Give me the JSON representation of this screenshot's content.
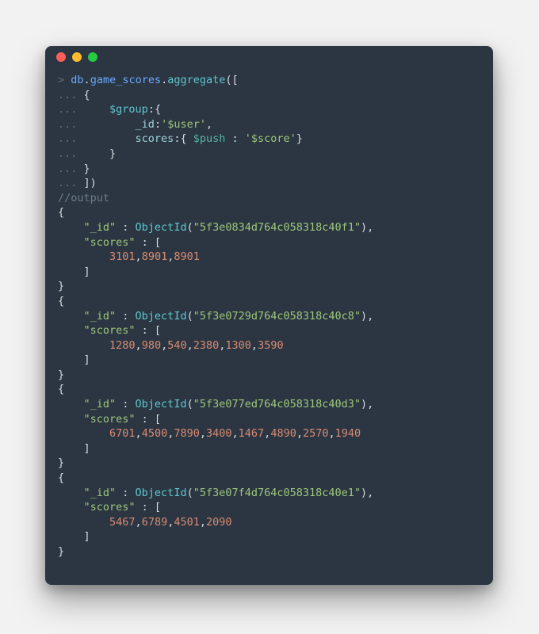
{
  "prompt": ">",
  "cont": "...",
  "cmd": {
    "obj": "db",
    "coll": "game_scores",
    "fn": "aggregate",
    "group_kw": "$group",
    "id_kw": "_id",
    "id_val": "'$user'",
    "scores_kw": "scores",
    "push_kw": "$push",
    "push_val": "'$score'"
  },
  "output_comment": "//output",
  "records": [
    {
      "id": "5f3e0834d764c058318c40f1",
      "scores": [
        3101,
        8901,
        8901
      ]
    },
    {
      "id": "5f3e0729d764c058318c40c8",
      "scores": [
        1280,
        980,
        540,
        2380,
        1300,
        3590
      ]
    },
    {
      "id": "5f3e077ed764c058318c40d3",
      "scores": [
        6701,
        4500,
        7890,
        3400,
        1467,
        4890,
        2570,
        1940
      ]
    },
    {
      "id": "5f3e07f4d764c058318c40e1",
      "scores": [
        5467,
        6789,
        4501,
        2090
      ]
    }
  ],
  "labels": {
    "id": "\"_id\"",
    "scores": "\"scores\"",
    "objectid": "ObjectId"
  }
}
